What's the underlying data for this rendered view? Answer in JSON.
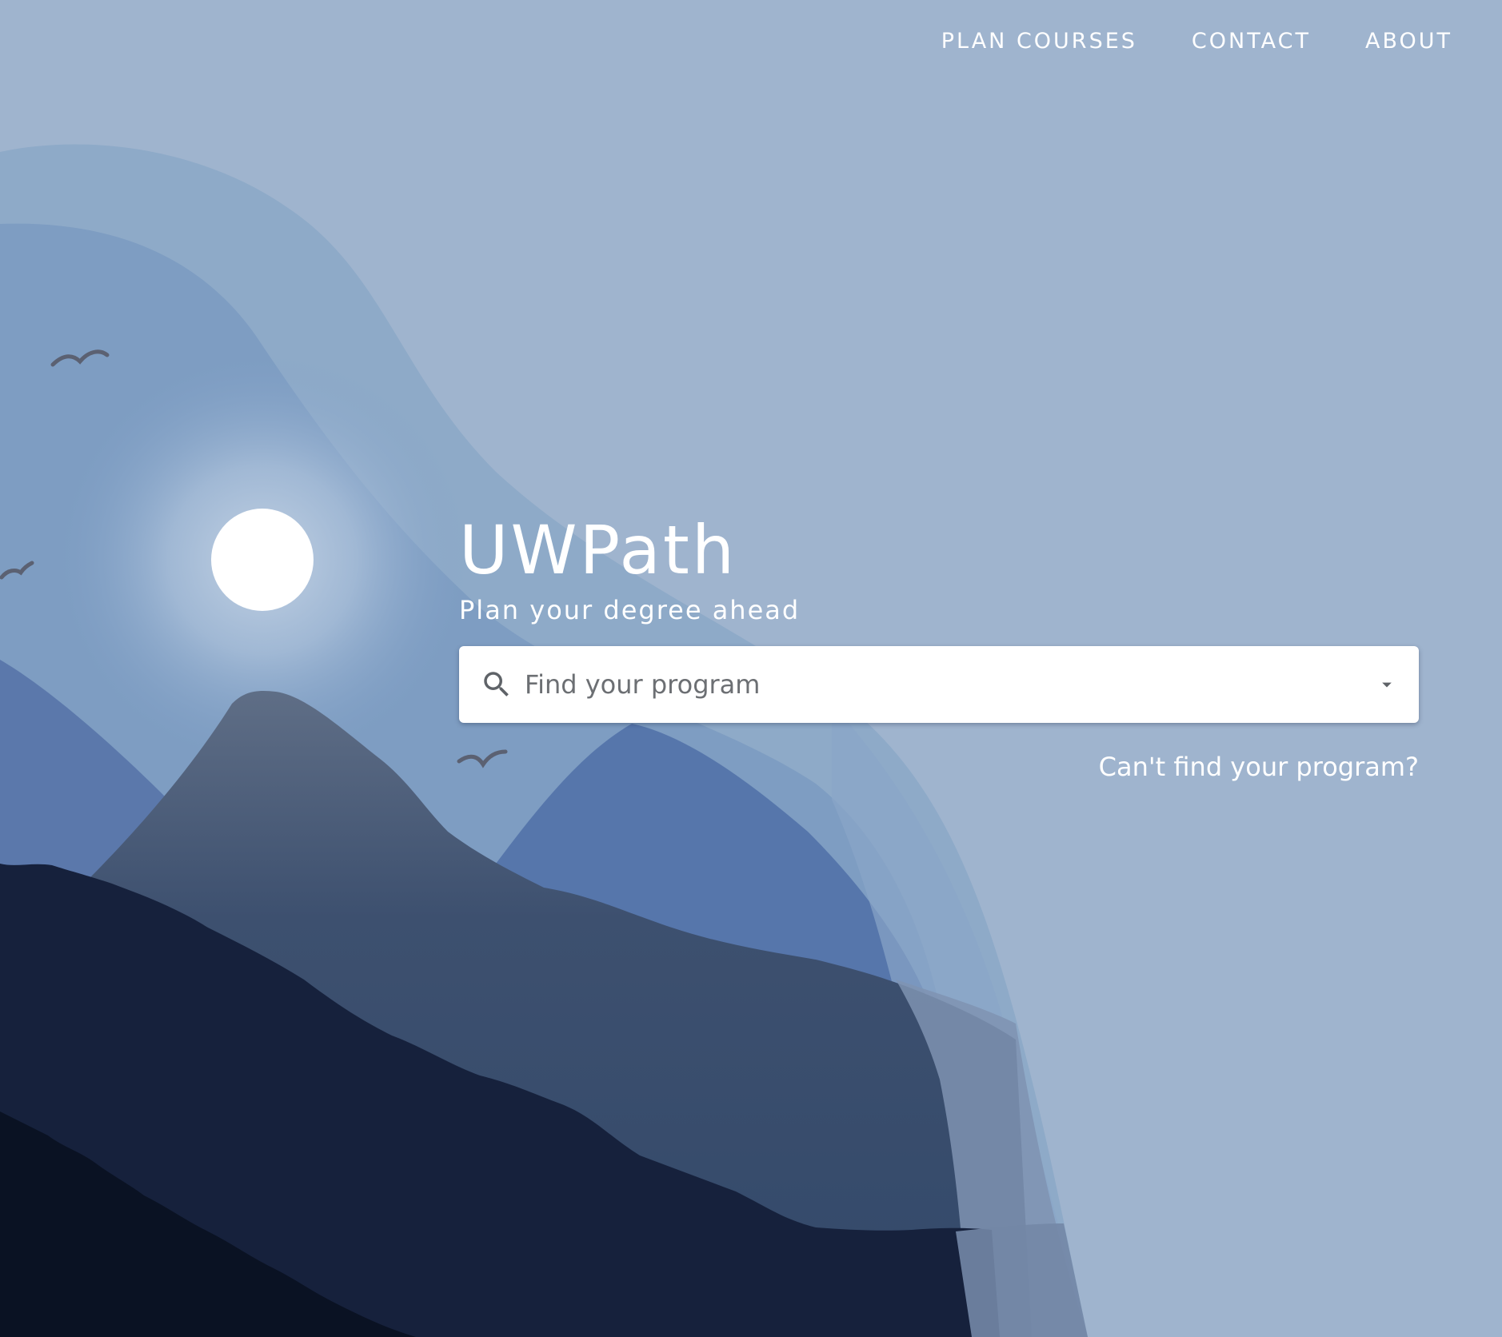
{
  "nav": {
    "items": [
      {
        "label": "PLAN COURSES"
      },
      {
        "label": "CONTACT"
      },
      {
        "label": "ABOUT"
      }
    ]
  },
  "hero": {
    "title": "UWPath",
    "subtitle": "Plan your degree ahead"
  },
  "search": {
    "placeholder": "Find your program",
    "icon": "search-icon",
    "dropdown_icon": "arrow-drop-down-icon"
  },
  "help": {
    "label": "Can't find your program?"
  },
  "colors": {
    "sky": "#9fb4ce",
    "sun": "#ffffff",
    "mountain_mid": "#33496a",
    "mountain_dark": "#16213c",
    "mountain_blue": "#5676ab",
    "text": "#ffffff"
  }
}
